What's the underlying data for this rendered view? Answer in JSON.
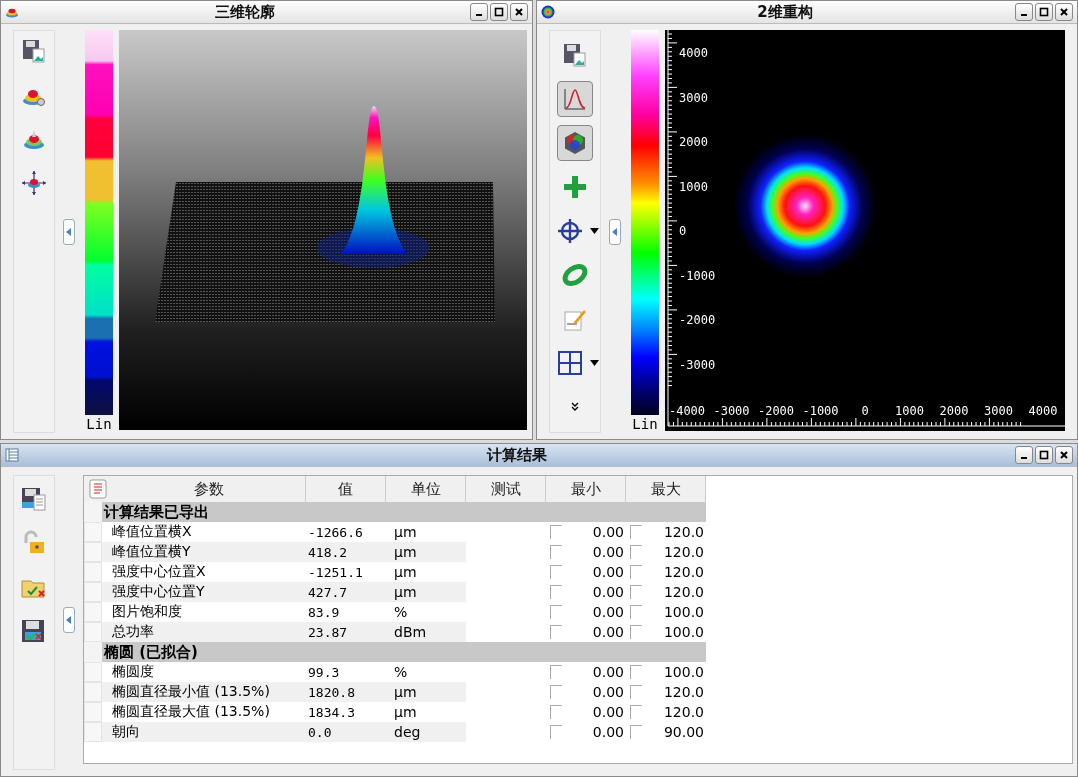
{
  "profile_3d": {
    "title": "三维轮廓",
    "colorbar_label": "Lin",
    "tools": [
      {
        "kind": "save-image"
      },
      {
        "kind": "beam-settings"
      },
      {
        "kind": "beam-3d"
      },
      {
        "kind": "beam-move"
      }
    ]
  },
  "reconstruction_2d": {
    "title": "2维重构",
    "colorbar_label": "Lin",
    "tools": [
      {
        "kind": "save-image",
        "pressed": false,
        "menu": false
      },
      {
        "kind": "profile",
        "pressed": true,
        "menu": false
      },
      {
        "kind": "palette",
        "pressed": true,
        "menu": false
      },
      {
        "kind": "plus",
        "pressed": false,
        "menu": false
      },
      {
        "kind": "crosshair",
        "pressed": false,
        "menu": true
      },
      {
        "kind": "ellipse",
        "pressed": false,
        "menu": false
      },
      {
        "kind": "edit",
        "pressed": false,
        "menu": false
      },
      {
        "kind": "grid",
        "pressed": false,
        "menu": true
      },
      {
        "kind": "more",
        "pressed": false,
        "menu": false
      }
    ],
    "y_ticks": [
      "4000",
      "3000",
      "2000",
      "1000",
      "0",
      "-1000",
      "-2000",
      "-3000"
    ],
    "x_ticks": [
      "-4000",
      "-3000",
      "-2000",
      "-1000",
      "0",
      "1000",
      "2000",
      "3000",
      "4000"
    ]
  },
  "results": {
    "title": "计算结果",
    "tools": [
      {
        "kind": "save-doc"
      },
      {
        "kind": "unlock"
      },
      {
        "kind": "folder-check"
      },
      {
        "kind": "disk-check"
      }
    ],
    "columns": [
      "参数",
      "值",
      "单位",
      "测试",
      "最小",
      "最大"
    ],
    "groups": [
      {
        "title": "计算结果已导出",
        "rows": [
          {
            "name": "峰值位置横X",
            "value": "-1266.6",
            "unit": "µm",
            "min_checked": false,
            "min": "0.00",
            "max_checked": false,
            "max": "120.0"
          },
          {
            "name": "峰值位置横Y",
            "value": "418.2",
            "unit": "µm",
            "min_checked": false,
            "min": "0.00",
            "max_checked": false,
            "max": "120.0"
          },
          {
            "name": "强度中心位置X",
            "value": "-1251.1",
            "unit": "µm",
            "min_checked": false,
            "min": "0.00",
            "max_checked": false,
            "max": "120.0"
          },
          {
            "name": "强度中心位置Y",
            "value": "427.7",
            "unit": "µm",
            "min_checked": false,
            "min": "0.00",
            "max_checked": false,
            "max": "120.0"
          },
          {
            "name": "图片饱和度",
            "value": "83.9",
            "unit": "%",
            "min_checked": false,
            "min": "0.00",
            "max_checked": false,
            "max": "100.0"
          },
          {
            "name": "总功率",
            "value": "23.87",
            "unit": "dBm",
            "min_checked": false,
            "min": "0.00",
            "max_checked": false,
            "max": "100.0"
          }
        ]
      },
      {
        "title": "椭圆 (已拟合)",
        "rows": [
          {
            "name": "椭圆度",
            "value": "99.3",
            "unit": "%",
            "min_checked": false,
            "min": "0.00",
            "max_checked": false,
            "max": "100.0"
          },
          {
            "name": "椭圆直径最小值 (13.5%)",
            "value": "1820.8",
            "unit": "µm",
            "min_checked": false,
            "min": "0.00",
            "max_checked": false,
            "max": "120.0"
          },
          {
            "name": "椭圆直径最大值 (13.5%)",
            "value": "1834.3",
            "unit": "µm",
            "min_checked": false,
            "min": "0.00",
            "max_checked": false,
            "max": "120.0"
          },
          {
            "name": "朝向",
            "value": "0.0",
            "unit": "deg",
            "min_checked": false,
            "min": "0.00",
            "max_checked": false,
            "max": "90.00"
          }
        ]
      }
    ]
  }
}
